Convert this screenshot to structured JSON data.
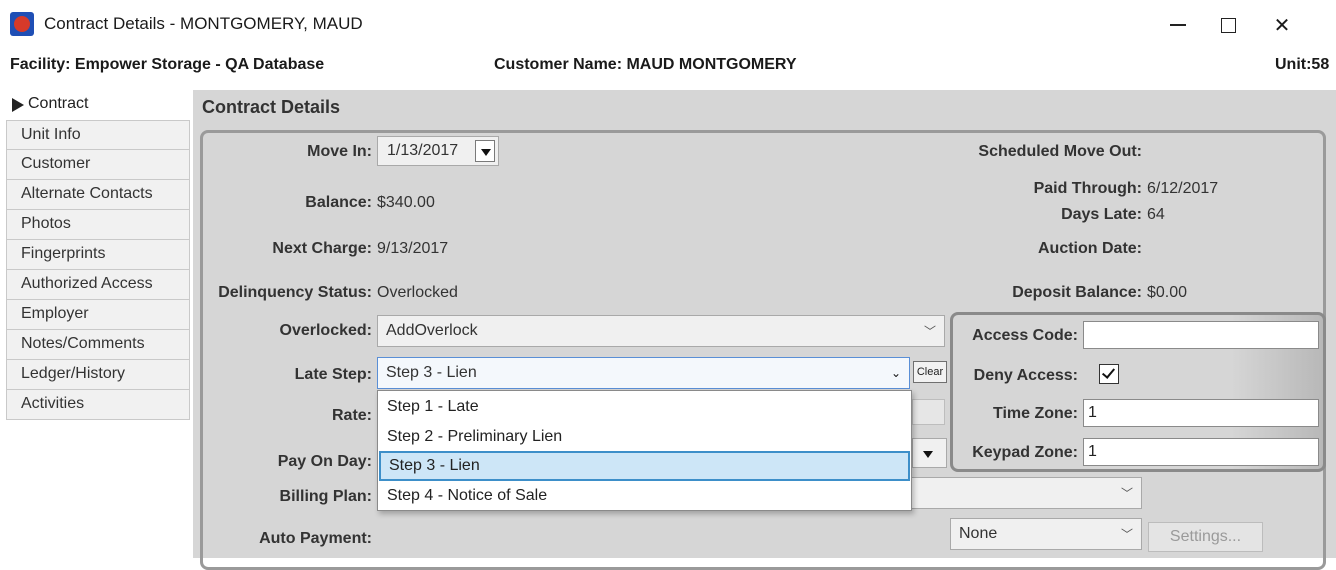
{
  "window": {
    "title": "Contract Details - MONTGOMERY, MAUD",
    "icon": "app-logo-icon",
    "controls": {
      "minimize": "minimize-icon",
      "maximize": "maximize-icon",
      "close": "✕"
    }
  },
  "header": {
    "facility": "Facility: Empower Storage - QA Database",
    "customer": "Customer Name: MAUD MONTGOMERY",
    "unit": "Unit:58"
  },
  "sidebar": {
    "items": [
      {
        "label": "Contract",
        "active": true
      },
      {
        "label": "Unit Info"
      },
      {
        "label": "Customer"
      },
      {
        "label": "Alternate Contacts"
      },
      {
        "label": "Photos"
      },
      {
        "label": "Fingerprints"
      },
      {
        "label": "Authorized Access"
      },
      {
        "label": "Employer"
      },
      {
        "label": "Notes/Comments"
      },
      {
        "label": "Ledger/History"
      },
      {
        "label": "Activities"
      }
    ]
  },
  "main": {
    "title": "Contract Details",
    "move_in": {
      "label": "Move In:",
      "value": "1/13/2017"
    },
    "balance": {
      "label": "Balance:",
      "value": "$340.00"
    },
    "next_charge": {
      "label": "Next Charge:",
      "value": "9/13/2017"
    },
    "delinquency": {
      "label": "Delinquency Status:",
      "value": "Overlocked"
    },
    "overlocked": {
      "label": "Overlocked:",
      "value": "AddOverlock"
    },
    "late_step": {
      "label": "Late Step:",
      "value": "Step 3 - Lien",
      "clear": "Clear"
    },
    "rate": {
      "label": "Rate:"
    },
    "pay_on_day": {
      "label": "Pay On Day:"
    },
    "billing_plan": {
      "label": "Billing Plan:"
    },
    "auto_payment": {
      "label": "Auto Payment:",
      "value": "None",
      "settings": "Settings..."
    },
    "scheduled_move_out": {
      "label": "Scheduled Move Out:"
    },
    "paid_through": {
      "label": "Paid Through:",
      "value": "6/12/2017"
    },
    "days_late": {
      "label": "Days Late:",
      "value": "64"
    },
    "auction_date": {
      "label": "Auction Date:"
    },
    "deposit_balance": {
      "label": "Deposit Balance:",
      "value": "$0.00"
    }
  },
  "access": {
    "access_code": {
      "label": "Access Code:",
      "value": ""
    },
    "deny_access": {
      "label": "Deny Access:",
      "checked": true
    },
    "time_zone": {
      "label": "Time Zone:",
      "value": "1"
    },
    "keypad_zone": {
      "label": "Keypad Zone:",
      "value": "1"
    }
  },
  "late_step_options": [
    {
      "label": "Step 1 - Late"
    },
    {
      "label": "Step 2 - Preliminary Lien"
    },
    {
      "label": "Step 3 - Lien",
      "selected": true
    },
    {
      "label": "Step 4 - Notice of Sale"
    }
  ],
  "colors": {
    "panel_bg": "#d6d6d6",
    "selection_bg": "#cde6f7",
    "selection_border": "#3d8fc9",
    "app_icon_blue": "#1f4fb5",
    "app_icon_red": "#d63a2a"
  }
}
